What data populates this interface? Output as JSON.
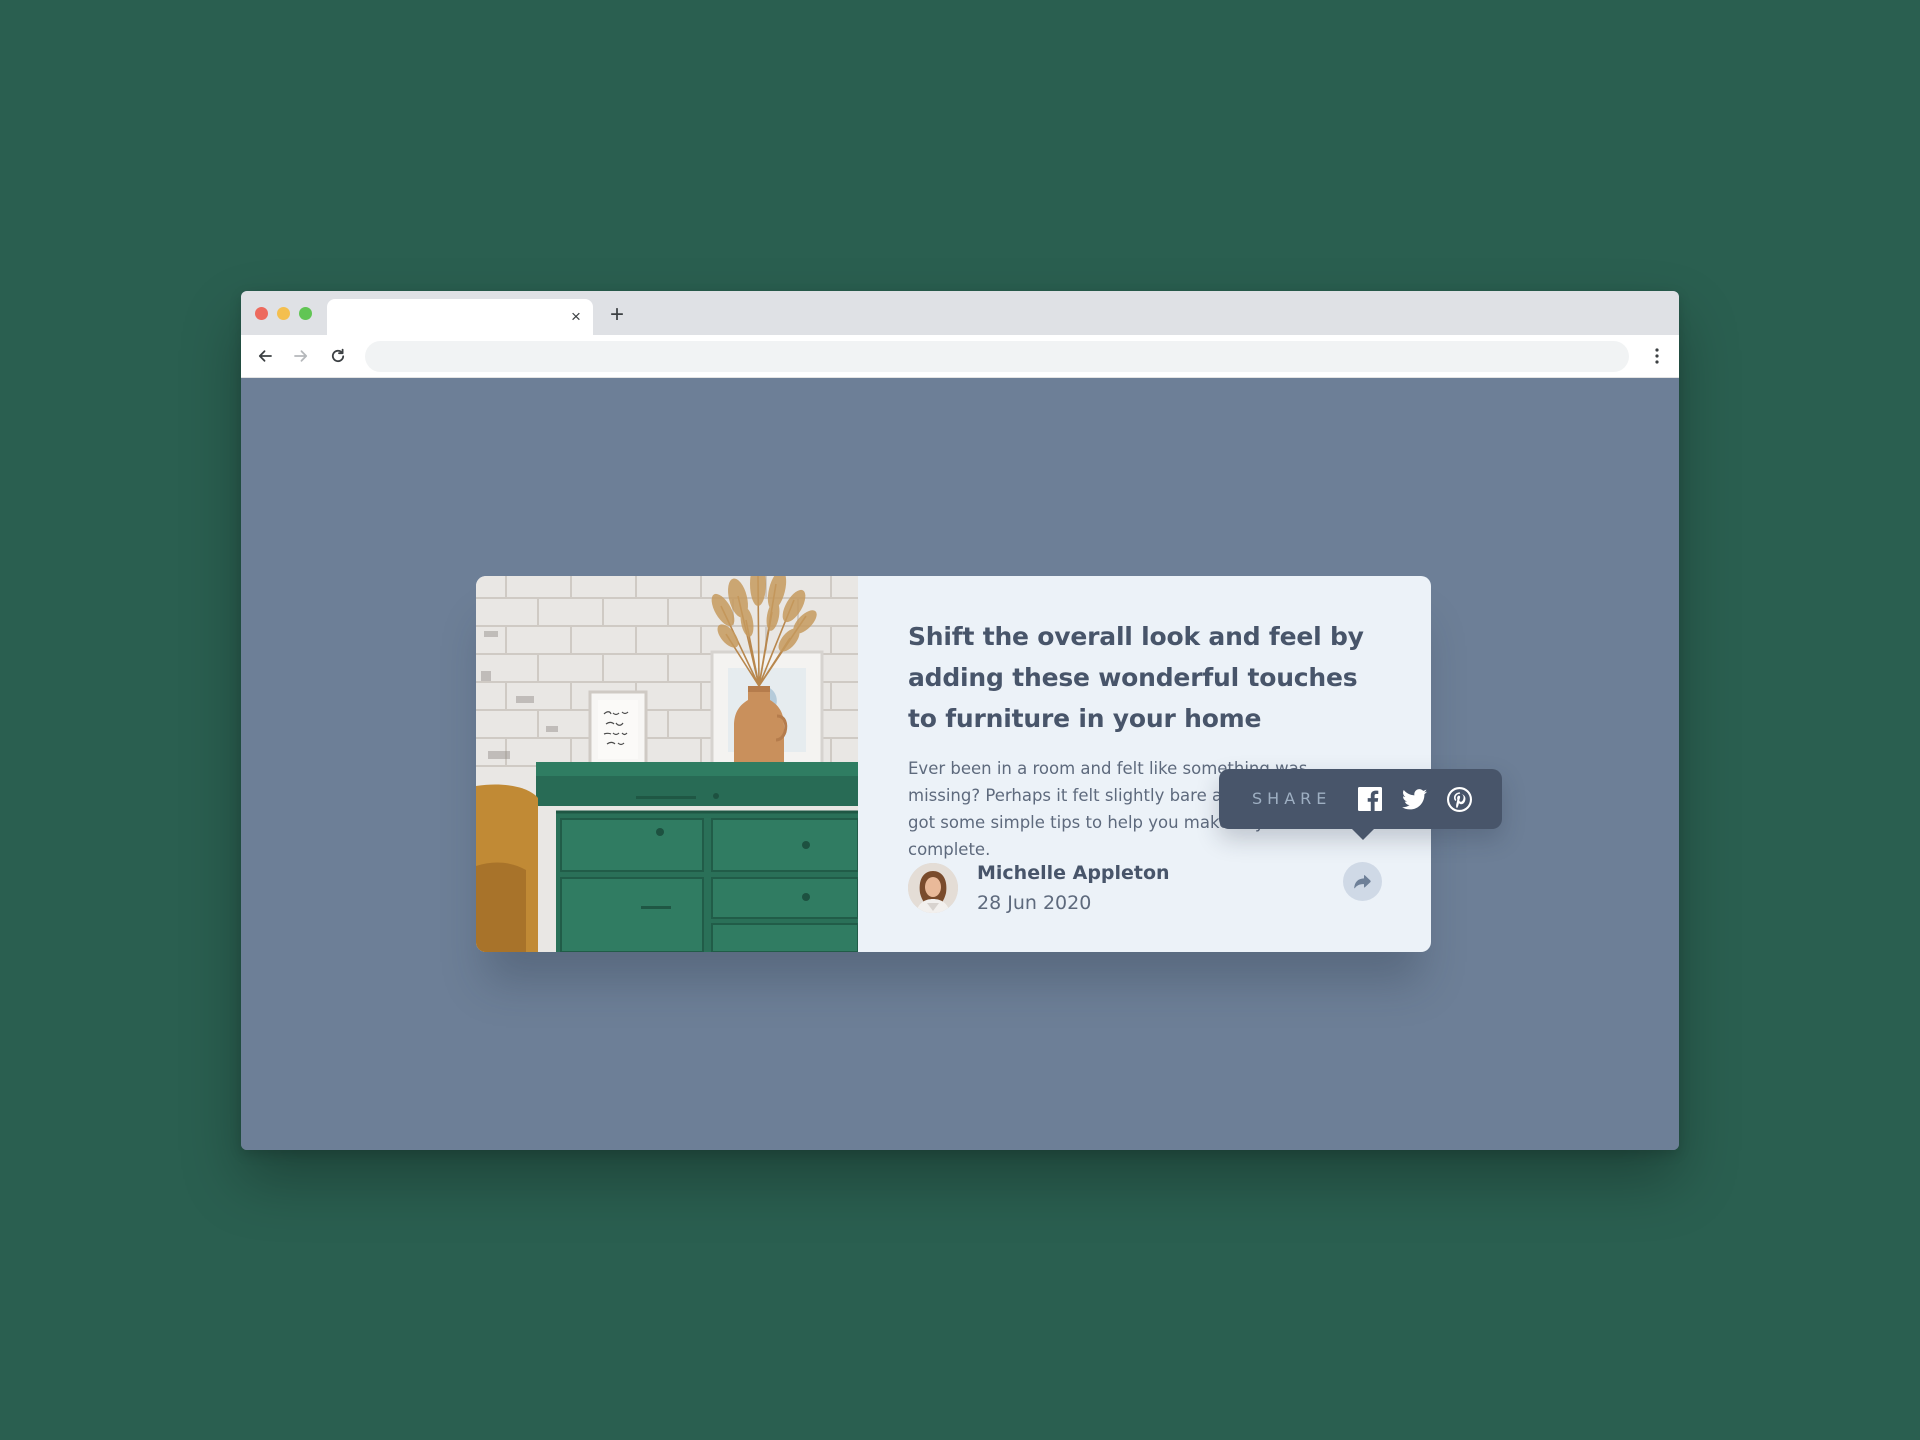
{
  "browser": {
    "tab_close_glyph": "×",
    "new_tab_glyph": "+",
    "address": ""
  },
  "article": {
    "title": "Shift the overall look and feel by adding these wonderful touches to furniture in your home",
    "excerpt": "Ever been in a room and felt like something was missing? Perhaps it felt slightly bare and uninviting. I’ve got some simple tips to help you make any room feel complete.",
    "author_name": "Michelle Appleton",
    "date": "28 Jun 2020"
  },
  "share": {
    "label": "SHARE",
    "networks": [
      "facebook",
      "twitter",
      "pinterest"
    ]
  },
  "colors": {
    "page_background": "#2a5f50",
    "viewport_background": "#6d7f97",
    "card_background": "#ecf2f8",
    "heading_text": "#48556a",
    "body_text": "#5e6a7d",
    "popover_background": "#48556a",
    "share_label": "#9eafc2",
    "share_button": "#cfd9e6"
  },
  "icons": {
    "back": "arrow-left-icon",
    "forward": "arrow-right-icon",
    "reload": "reload-icon",
    "menu": "vertical-dots-icon",
    "share": "share-arrow-icon",
    "facebook": "facebook-icon",
    "twitter": "twitter-icon",
    "pinterest": "pinterest-icon"
  }
}
